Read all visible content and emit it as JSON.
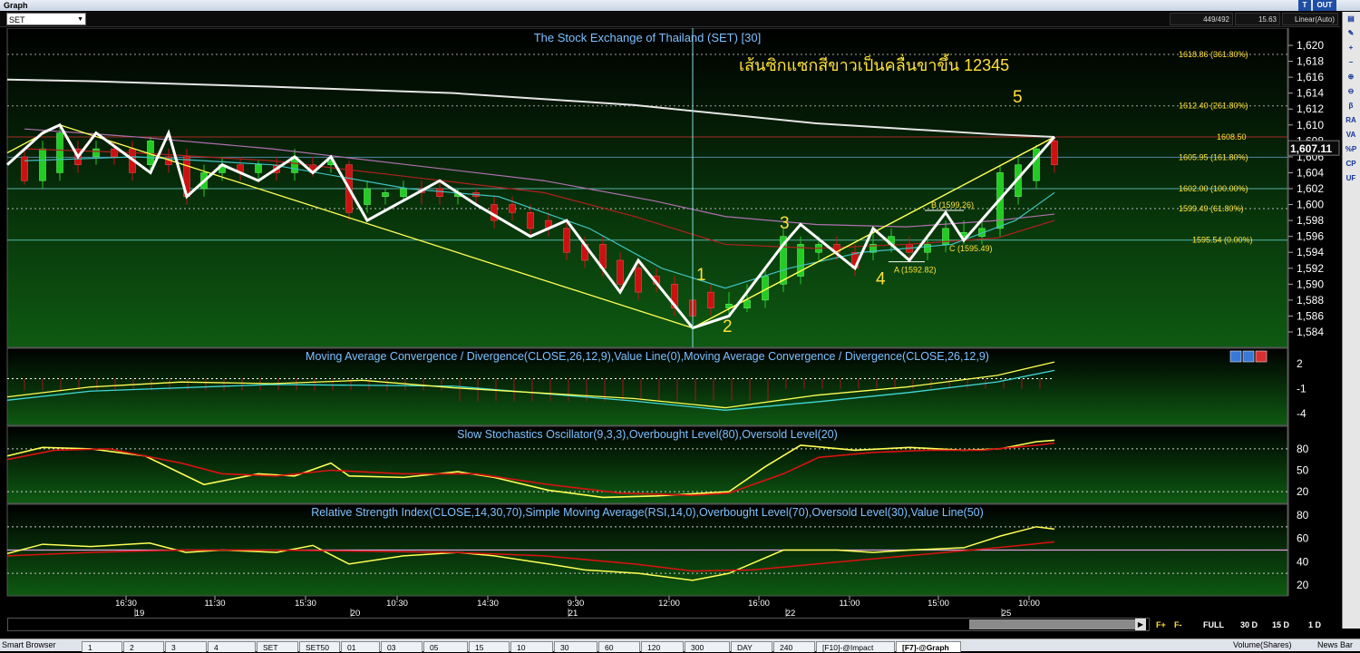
{
  "window": {
    "title": "Graph",
    "btn_t": "T",
    "btn_out": "OUT"
  },
  "toolbar": {
    "symbol": "SET",
    "bar_count": "449/492",
    "value": "15.63",
    "scale_mode": "Linear(Auto)"
  },
  "chart": {
    "title": "The Stock Exchange of Thailand (SET) [30]",
    "thai_note": "เส้นซิกแซกสีขาวเป็นคลื่นขาขึ้น 12345",
    "last_price": "1,607.11",
    "price_axis": [
      "1,620",
      "1,618",
      "1,616",
      "1,614",
      "1,612",
      "1,610",
      "1,608",
      "1,606",
      "1,604",
      "1,602",
      "1,600",
      "1,598",
      "1,596",
      "1,594",
      "1,592",
      "1,590",
      "1,588",
      "1,586",
      "1,584"
    ],
    "fib_labels": [
      "1618.86 (361.80%)",
      "1612.40 (261.80%)",
      "1608.50",
      "1605.95 (161.80%)",
      "1602.00 (100.00%)",
      "1599.49 (61.80%)",
      "1595.54 (0.00%)"
    ],
    "wave_labels": [
      "1",
      "2",
      "3",
      "4",
      "5"
    ],
    "abc_labels": [
      "B (1599.26)",
      "C (1595.49)",
      "A (1592.82)"
    ],
    "time_labels": [
      "16:30",
      "11:30",
      "15:30",
      "10:30",
      "14:30",
      "9:30",
      "12:00",
      "16:00",
      "11:00",
      "15:00",
      "10:00"
    ],
    "date_labels": [
      "19",
      "20",
      "21",
      "22",
      "25"
    ],
    "colors": {
      "bg_top": "#000000",
      "bg_bottom": "#0e5a12",
      "zigzag": "#ffffff",
      "trendline": "#ffff55",
      "bull": "#22cc22",
      "bear": "#cc1111",
      "accent_text": "#ffe23a"
    }
  },
  "macd": {
    "title": "Moving Average Convergence / Divergence(CLOSE,26,12,9),Value Line(0),Moving Average Convergence / Divergence(CLOSE,26,12,9)",
    "axis": [
      "2",
      "-1",
      "-4"
    ]
  },
  "stoch": {
    "title": "Slow Stochastics Oscillator(9,3,3),Overbought Level(80),Oversold Level(20)",
    "axis": [
      "80",
      "50",
      "20"
    ]
  },
  "rsi": {
    "title": "Relative Strength Index(CLOSE,14,30,70),Simple Moving Average(RSI,14,0),Overbought Level(70),Oversold Level(30),Value Line(50)",
    "axis": [
      "80",
      "60",
      "40",
      "20"
    ]
  },
  "controls": {
    "f_plus": "F+",
    "f_minus": "F-",
    "full": "FULL",
    "d30": "30 D",
    "d15": "15 D",
    "d1": "1 D"
  },
  "bottom": {
    "smart_browser": "Smart Browser",
    "tabs": [
      "1",
      "2",
      "3",
      "4",
      "SET",
      "SET50",
      "01",
      "03",
      "05",
      "15",
      "10",
      "30",
      "60",
      "120",
      "300",
      "DAY",
      "240",
      "[F10]-@Impact",
      "[F7]-@Graph"
    ],
    "volume": "Volume(Shares)",
    "news": "News Bar"
  },
  "rightbar_icons": [
    "graph-icon",
    "pencil-icon",
    "add-icon",
    "remove-icon",
    "zoom-in-icon",
    "zoom-out-icon",
    "beta-icon",
    "ra-icon",
    "va-icon",
    "percent-icon",
    "cp-icon",
    "uf-icon"
  ],
  "rightbar_labels": [
    "β",
    "RA",
    "VA",
    "%P",
    "CP",
    "UF"
  ]
}
